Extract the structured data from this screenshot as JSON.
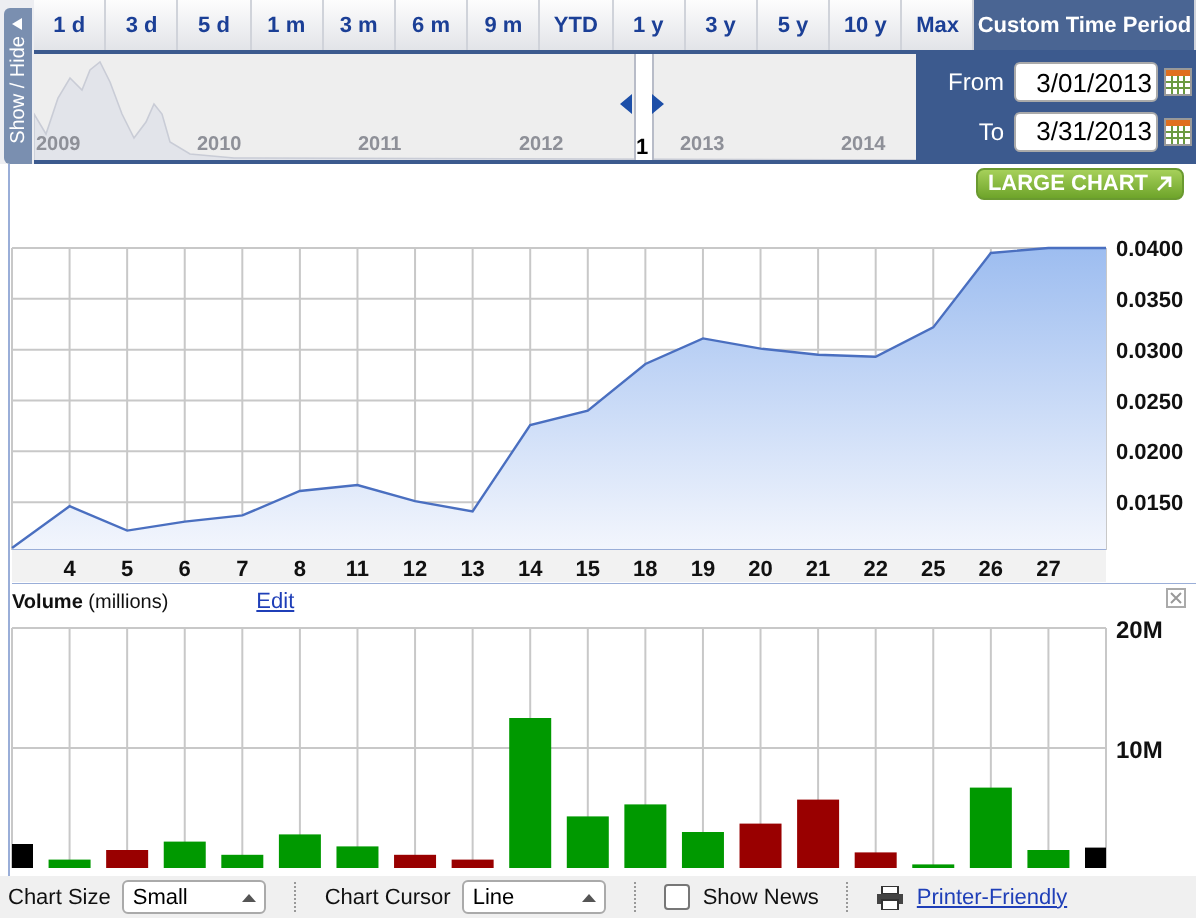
{
  "tabs": [
    {
      "label": "1 d",
      "selected": false
    },
    {
      "label": "3 d",
      "selected": false
    },
    {
      "label": "5 d",
      "selected": false
    },
    {
      "label": "1 m",
      "selected": false
    },
    {
      "label": "3 m",
      "selected": false
    },
    {
      "label": "6 m",
      "selected": false
    },
    {
      "label": "9 m",
      "selected": false
    },
    {
      "label": "YTD",
      "selected": false
    },
    {
      "label": "1 y",
      "selected": false
    },
    {
      "label": "3 y",
      "selected": false
    },
    {
      "label": "5 y",
      "selected": false
    },
    {
      "label": "10 y",
      "selected": false
    },
    {
      "label": "Max",
      "selected": false
    },
    {
      "label": "Custom Time Period",
      "selected": true
    }
  ],
  "navigator": {
    "toggle_label": "Show / Hide",
    "years": [
      "2009",
      "2010",
      "2011",
      "2012",
      "2013",
      "2014"
    ],
    "handle_label": "1"
  },
  "date_range": {
    "from_label": "From",
    "from_value": "3/01/2013",
    "to_label": "To",
    "to_value": "3/31/2013"
  },
  "large_chart_button": "LARGE CHART",
  "price_chart": {
    "chart_data": {
      "type": "area",
      "categories": [
        null,
        "4",
        "5",
        "6",
        "7",
        "8",
        "11",
        "12",
        "13",
        "14",
        "15",
        "18",
        "19",
        "20",
        "21",
        "22",
        "25",
        "26",
        "27",
        null
      ],
      "series": [
        {
          "color": "#4a6fc0",
          "values": [
            0.0105,
            0.0146,
            0.0122,
            0.0131,
            0.0137,
            0.0161,
            0.0167,
            0.0151,
            0.0141,
            0.0226,
            0.024,
            0.0286,
            0.0311,
            0.0301,
            0.0295,
            0.0293,
            0.0322,
            0.0395,
            0.04,
            0.04
          ]
        }
      ],
      "ylim": [
        0.0103,
        0.04
      ],
      "grid": true,
      "yticks": [
        {
          "value": 0.015,
          "label": "0.0150"
        },
        {
          "value": 0.02,
          "label": "0.0200"
        },
        {
          "value": 0.025,
          "label": "0.0250"
        },
        {
          "value": 0.03,
          "label": "0.0300"
        },
        {
          "value": 0.035,
          "label": "0.0350"
        },
        {
          "value": 0.04,
          "label": "0.0400"
        }
      ]
    }
  },
  "volume_chart": {
    "title": "Volume",
    "unit": "(millions)",
    "edit_link": "Edit",
    "chart_data": {
      "type": "bar",
      "stacked": true,
      "categories": [
        null,
        null,
        null,
        null,
        null,
        null,
        null,
        null,
        null,
        null,
        null,
        null,
        null,
        null,
        null,
        null,
        null,
        null,
        null,
        null
      ],
      "series": [
        {
          "color": "#000000",
          "values": [
            2.0,
            null,
            null,
            null,
            null,
            null,
            null,
            null,
            null,
            null,
            null,
            null,
            null,
            null,
            null,
            null,
            null,
            null,
            null,
            1.7
          ]
        },
        {
          "color": "#009900",
          "values": [
            null,
            0.7,
            null,
            2.2,
            1.1,
            2.8,
            1.8,
            null,
            null,
            12.5,
            4.3,
            5.3,
            3.0,
            null,
            null,
            null,
            0.3,
            6.7,
            1.5,
            null
          ]
        },
        {
          "color": "#990000",
          "values": [
            null,
            null,
            1.5,
            null,
            null,
            null,
            null,
            1.1,
            0.7,
            null,
            null,
            null,
            null,
            3.7,
            5.7,
            1.3,
            null,
            null,
            null,
            null
          ]
        }
      ],
      "ylim": [
        0,
        20
      ],
      "grid": true,
      "yticks": [
        {
          "value": 10,
          "label": "10M"
        },
        {
          "value": 20,
          "label": "20M"
        }
      ]
    }
  },
  "toolbar": {
    "chart_size_label": "Chart Size",
    "chart_size_value": "Small",
    "cursor_label": "Chart Cursor",
    "cursor_value": "Line",
    "show_news_label": "Show News",
    "show_news_checked": false,
    "printer_link": "Printer-Friendly"
  }
}
